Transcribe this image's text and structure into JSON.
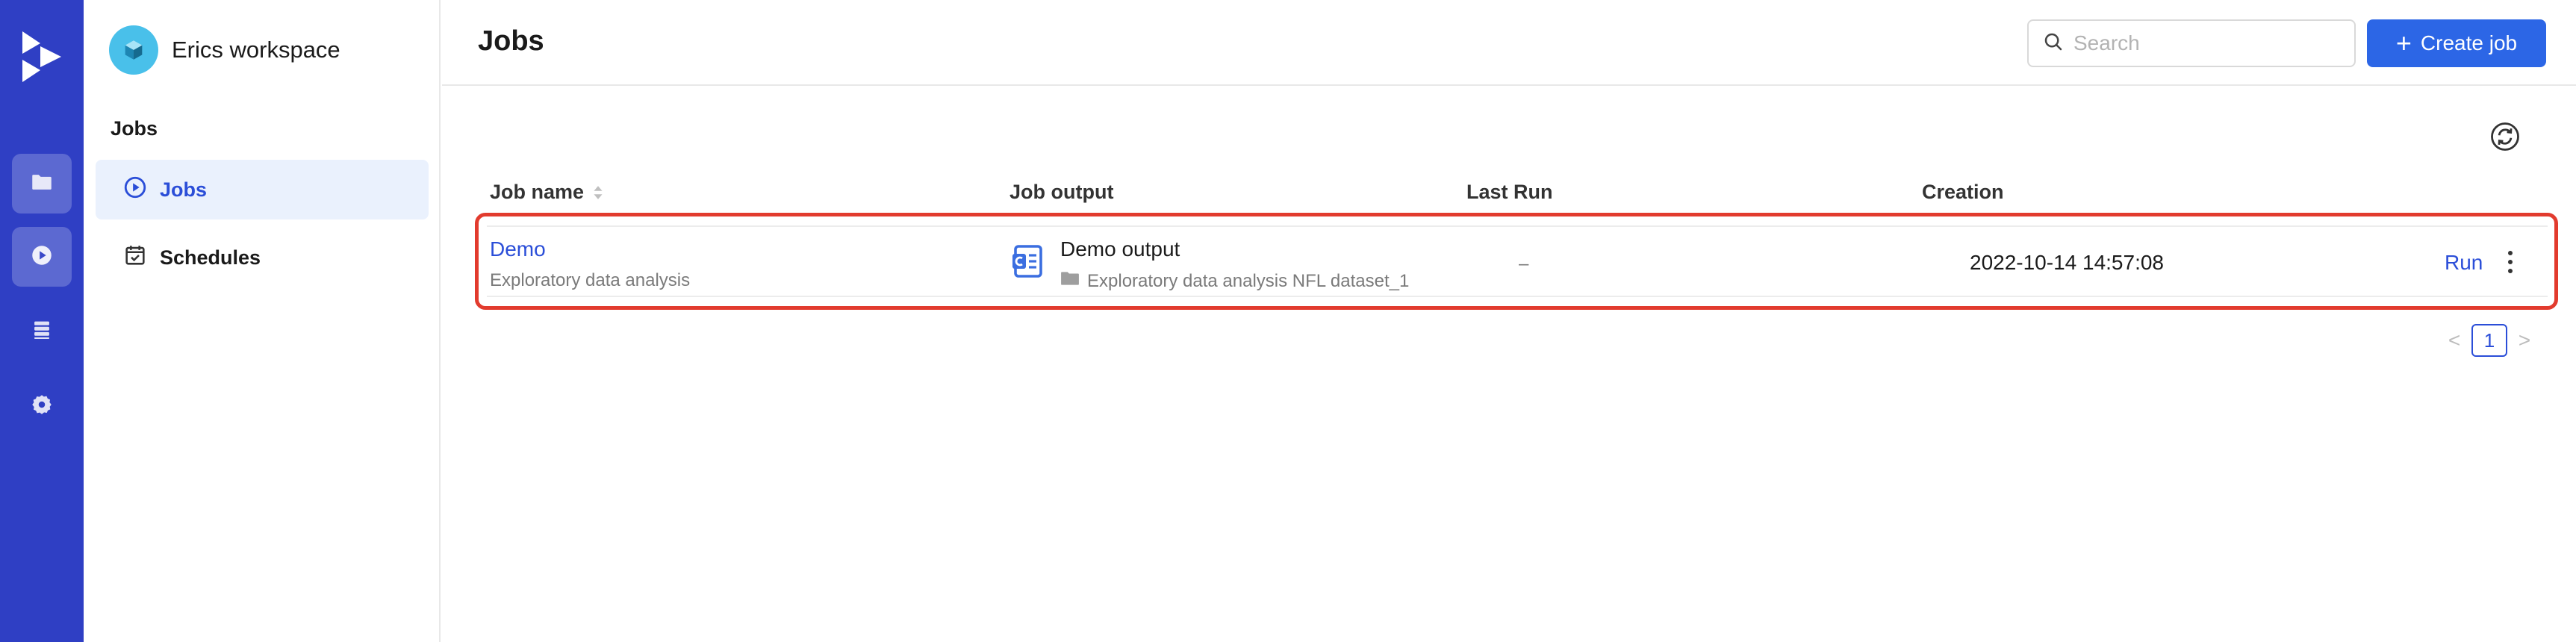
{
  "rail": {
    "items": [
      {
        "icon": "folder-icon"
      },
      {
        "icon": "play-circle-icon"
      },
      {
        "icon": "database-icon"
      },
      {
        "icon": "gear-icon"
      }
    ]
  },
  "sidebar": {
    "workspace_name": "Erics workspace",
    "section_label": "Jobs",
    "items": [
      {
        "label": "Jobs",
        "icon": "play-circle-icon",
        "active": true
      },
      {
        "label": "Schedules",
        "icon": "calendar-icon",
        "active": false
      }
    ]
  },
  "header": {
    "title": "Jobs",
    "search_placeholder": "Search",
    "create_label": "Create job"
  },
  "table": {
    "columns": [
      "Job name",
      "Job output",
      "Last Run",
      "Creation"
    ],
    "rows": [
      {
        "name": "Demo",
        "description": "Exploratory data analysis",
        "output_title": "Demo output",
        "output_path": "Exploratory data analysis NFL dataset_1",
        "last_run": "–",
        "creation": "2022-10-14 14:57:08",
        "action": "Run"
      }
    ]
  },
  "pagination": {
    "current_page": "1",
    "prev": "<",
    "next": ">"
  },
  "colors": {
    "rail": "#2f3fc4",
    "accent": "#2c66e6",
    "link": "#2b4ed8",
    "highlight_outline": "#e23b2e"
  }
}
